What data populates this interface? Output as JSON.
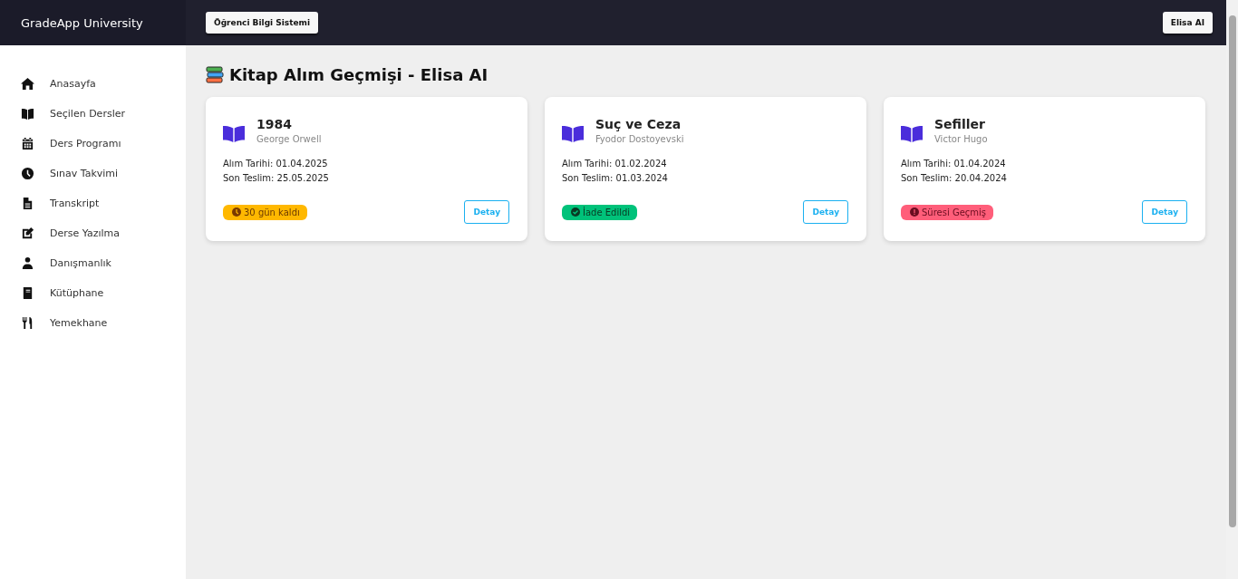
{
  "brand": "GradeApp University",
  "header": {
    "left_button": "Öğrenci Bilgi Sistemi",
    "user_button": "Elisa AI"
  },
  "sidebar": {
    "items": [
      {
        "label": "Anasayfa"
      },
      {
        "label": "Seçilen Dersler"
      },
      {
        "label": "Ders Programı"
      },
      {
        "label": "Sınav Takvimi"
      },
      {
        "label": "Transkript"
      },
      {
        "label": "Derse Yazılma"
      },
      {
        "label": "Danışmanlık"
      },
      {
        "label": "Kütüphane"
      },
      {
        "label": "Yemekhane"
      }
    ]
  },
  "page_title": "Kitap Alım Geçmişi - Elisa AI",
  "books": [
    {
      "title": "1984",
      "author": "George Orwell",
      "purchase": "Alım Tarihi: 01.04.2025",
      "due": "Son Teslim: 25.05.2025",
      "status": {
        "kind": "remaining",
        "label": "30 gün kaldı"
      },
      "button": "Detay"
    },
    {
      "title": "Suç ve Ceza",
      "author": "Fyodor Dostoyevski",
      "purchase": "Alım Tarihi: 01.02.2024",
      "due": "Son Teslim: 01.03.2024",
      "status": {
        "kind": "returned",
        "label": "İade Edildi"
      },
      "button": "Detay"
    },
    {
      "title": "Sefiller",
      "author": "Victor Hugo",
      "purchase": "Alım Tarihi: 01.04.2024",
      "due": "Son Teslim: 20.04.2024",
      "status": {
        "kind": "overdue",
        "label": "Süresi Geçmiş"
      },
      "button": "Detay"
    }
  ]
}
